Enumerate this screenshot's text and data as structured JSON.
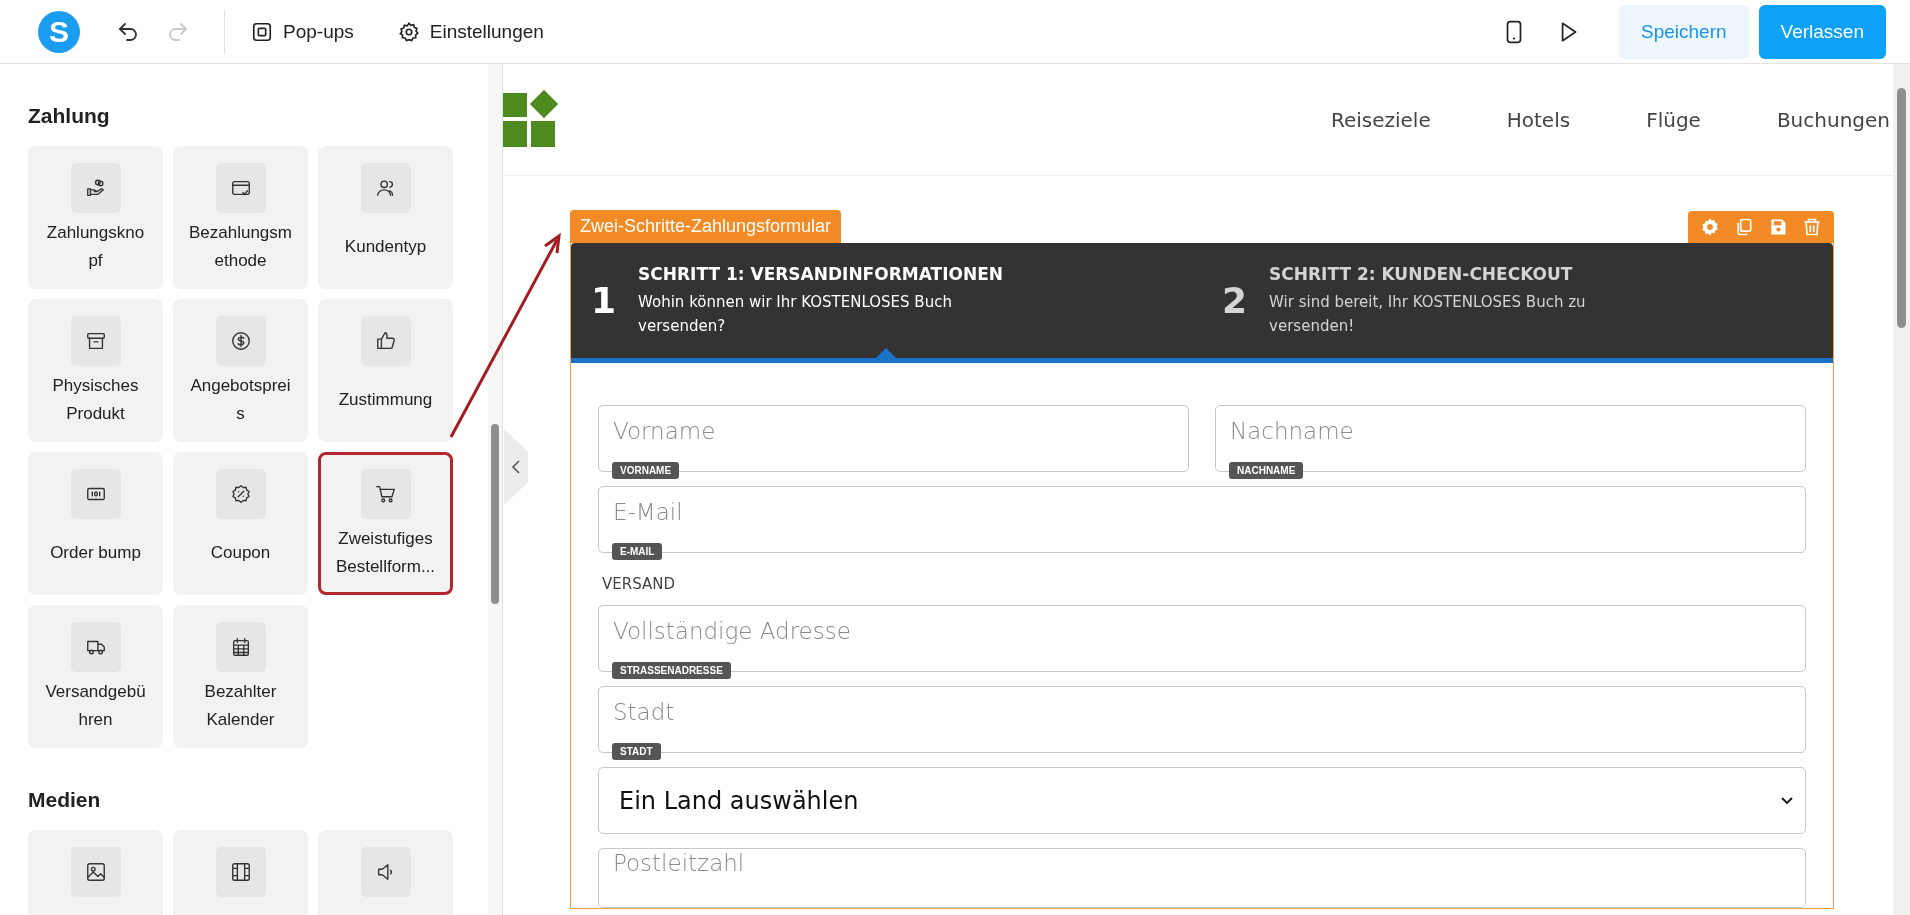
{
  "topbar": {
    "logo": "S",
    "history": [
      {
        "kind": "undo",
        "disabled": false
      },
      {
        "kind": "redo",
        "disabled": true
      }
    ],
    "menu": [
      {
        "kind": "popups",
        "label": "Pop-ups"
      },
      {
        "kind": "settings",
        "label": "Einstellungen"
      }
    ],
    "actions": [
      {
        "kind": "preview-mobile"
      },
      {
        "kind": "play"
      }
    ],
    "buttons": [
      {
        "kind": "secondary",
        "label": "Speichern"
      },
      {
        "kind": "primary",
        "label": "Verlassen"
      }
    ]
  },
  "sidebar": {
    "sections": [
      {
        "title": "Zahlung",
        "items": [
          {
            "label": "Zahlungsknopf",
            "selected": false
          },
          {
            "label": "Bezahlungsmethode",
            "selected": false
          },
          {
            "label": "Kundentyp",
            "selected": false
          },
          {
            "label": "Physisches Produkt",
            "selected": false
          },
          {
            "label": "Angebotspreis",
            "selected": false
          },
          {
            "label": "Zustimmung",
            "selected": false
          },
          {
            "label": "Order bump",
            "selected": false
          },
          {
            "label": "Coupon",
            "selected": false
          },
          {
            "label": "Zweistufiges Bestellform...",
            "selected": true
          },
          {
            "label": "Versandgebühren",
            "selected": false
          },
          {
            "label": "Bezahlter Kalender",
            "selected": false
          }
        ]
      },
      {
        "title": "Medien",
        "items": [
          {
            "selected": false
          },
          {
            "selected": false
          },
          {
            "selected": false
          }
        ]
      }
    ]
  },
  "site": {
    "nav": [
      "Reiseziele",
      "Hotels",
      "Flüge",
      "Buchungen"
    ]
  },
  "element": {
    "label": "Zwei-Schritte-Zahlungsformular",
    "steps": [
      {
        "number": "1",
        "title": "SCHRITT 1: VERSANDINFORMATIONEN",
        "text": "Wohin können wir Ihr KOSTENLOSES Buch versenden?",
        "selected": true
      },
      {
        "number": "2",
        "title": "SCHRITT 2: KUNDEN-CHECKOUT",
        "text": "Wir sind bereit, Ihr KOSTENLOSES Buch zu versenden!",
        "selected": false
      }
    ],
    "rows": [
      {
        "kind": "pair",
        "fields": [
          {
            "placeholder": "Vorname",
            "tag": "VORNAME"
          },
          {
            "placeholder": "Nachname",
            "tag": "NACHNAME"
          }
        ]
      },
      {
        "kind": "input",
        "fields": [
          {
            "placeholder": "E-Mail",
            "tag": "E-MAIL"
          }
        ]
      },
      {
        "kind": "heading",
        "text": "VERSAND"
      },
      {
        "kind": "input",
        "fields": [
          {
            "placeholder": "Vollständige Adresse",
            "tag": "STRASSENADRESSE"
          }
        ]
      },
      {
        "kind": "input",
        "fields": [
          {
            "placeholder": "Stadt",
            "tag": "STADT"
          }
        ]
      },
      {
        "kind": "select",
        "value": "Ein Land auswählen"
      },
      {
        "kind": "input",
        "fields": [
          {
            "placeholder": "Postleitzahl"
          }
        ]
      }
    ]
  }
}
